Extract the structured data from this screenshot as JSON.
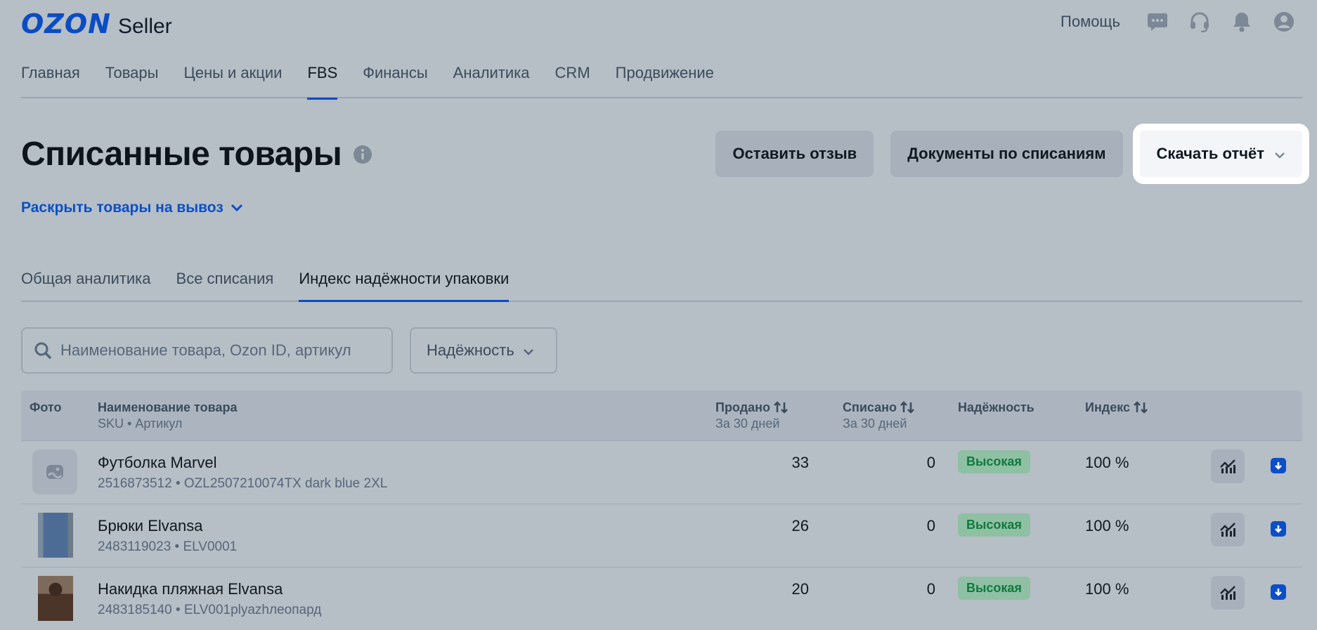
{
  "header": {
    "logo_brand": "OZON",
    "logo_suffix": "Seller",
    "help_label": "Помощь",
    "icons": [
      "chat-icon",
      "headset-icon",
      "bell-icon",
      "profile-icon"
    ]
  },
  "nav": {
    "items": [
      {
        "label": "Главная"
      },
      {
        "label": "Товары"
      },
      {
        "label": "Цены и акции"
      },
      {
        "label": "FBS",
        "active": true
      },
      {
        "label": "Финансы"
      },
      {
        "label": "Аналитика"
      },
      {
        "label": "CRM"
      },
      {
        "label": "Продвижение"
      }
    ]
  },
  "page": {
    "title": "Списанные товары",
    "expand_link": "Раскрыть товары на вывоз",
    "buttons": {
      "feedback": "Оставить отзыв",
      "documents": "Документы по списаниям",
      "download": "Скачать отчёт"
    }
  },
  "tabs": {
    "items": [
      {
        "label": "Общая аналитика"
      },
      {
        "label": "Все списания"
      },
      {
        "label": "Индекс надёжности упаковки",
        "active": true
      }
    ]
  },
  "filters": {
    "search_placeholder": "Наименование товара, Ozon ID, артикул",
    "reliability_select": "Надёжность"
  },
  "table": {
    "headers": {
      "photo": "Фото",
      "name": "Наименование товара",
      "name_sub": "SKU • Артикул",
      "sold": "Продано",
      "sold_sub": "За 30 дней",
      "written_off": "Списано",
      "written_off_sub": "За 30 дней",
      "reliability": "Надёжность",
      "index": "Индекс"
    },
    "rows": [
      {
        "name": "Футболка Marvel",
        "sku": "2516873512 • OZL2507210074TX dark blue 2XL",
        "sold": "33",
        "written_off": "0",
        "reliability": "Высокая",
        "index": "100 %"
      },
      {
        "name": "Брюки Elvansa",
        "sku": "2483119023 • ELV0001",
        "sold": "26",
        "written_off": "0",
        "reliability": "Высокая",
        "index": "100 %"
      },
      {
        "name": "Накидка пляжная Elvansa",
        "sku": "2483185140 • ELV001plyazhлеопард",
        "sold": "20",
        "written_off": "0",
        "reliability": "Высокая",
        "index": "100 %"
      }
    ]
  },
  "colors": {
    "background": "#b6bec6",
    "accent": "#0a4cc4",
    "success_text": "#107a3c",
    "success_bg": "#8fc0a4"
  }
}
